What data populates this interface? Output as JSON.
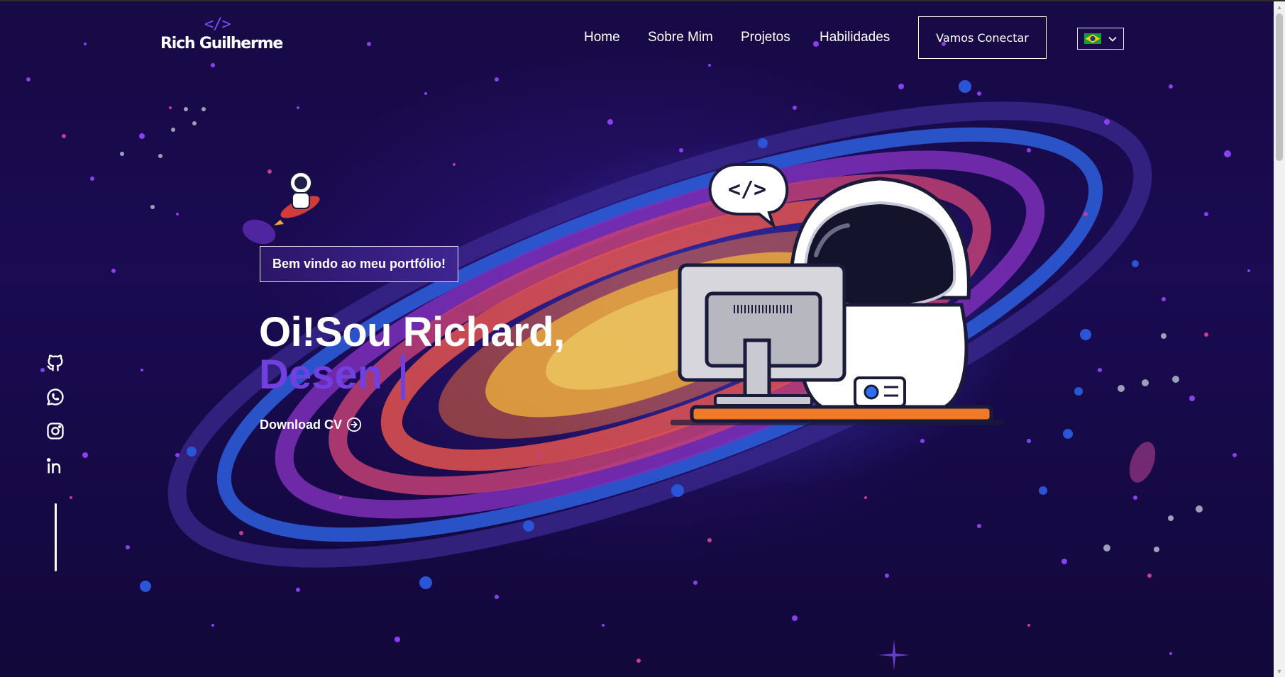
{
  "brand": {
    "code_symbol": "</>",
    "name": "Rich Guilherme"
  },
  "nav": {
    "items": [
      "Home",
      "Sobre Mim",
      "Projetos",
      "Habilidades"
    ],
    "cta_label": "Vamos Conectar"
  },
  "language": {
    "selected_flag": "brazil-flag-icon"
  },
  "social": [
    "github-icon",
    "whatsapp-icon",
    "instagram-icon",
    "linkedin-icon"
  ],
  "hero": {
    "badge": "Bem vindo ao meu portfólio!",
    "title": "Oi!Sou Richard,",
    "typed_text": "Desen",
    "download_label": "Download CV"
  },
  "illustration": {
    "speech_bubble_code": "</>"
  },
  "colors": {
    "accent_purple": "#7240e0",
    "background": "#170a45",
    "text": "#ffffff"
  }
}
